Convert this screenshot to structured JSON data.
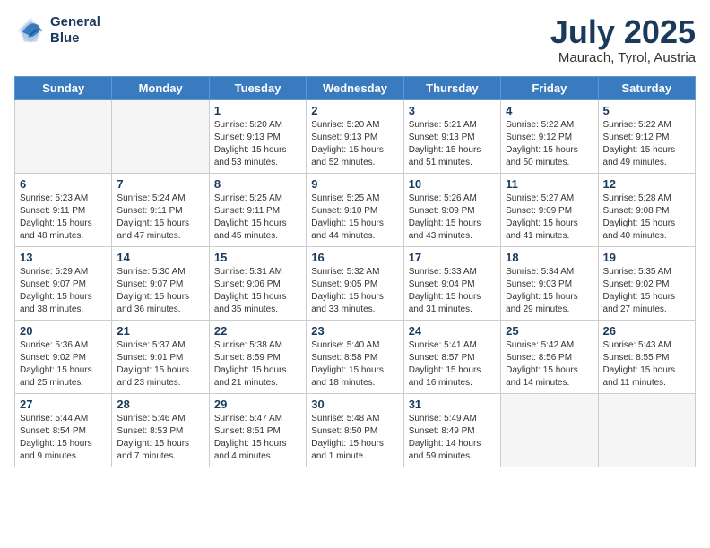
{
  "logo": {
    "line1": "General",
    "line2": "Blue"
  },
  "title": "July 2025",
  "subtitle": "Maurach, Tyrol, Austria",
  "days_of_week": [
    "Sunday",
    "Monday",
    "Tuesday",
    "Wednesday",
    "Thursday",
    "Friday",
    "Saturday"
  ],
  "weeks": [
    [
      {
        "day": "",
        "detail": ""
      },
      {
        "day": "",
        "detail": ""
      },
      {
        "day": "1",
        "detail": "Sunrise: 5:20 AM\nSunset: 9:13 PM\nDaylight: 15 hours\nand 53 minutes."
      },
      {
        "day": "2",
        "detail": "Sunrise: 5:20 AM\nSunset: 9:13 PM\nDaylight: 15 hours\nand 52 minutes."
      },
      {
        "day": "3",
        "detail": "Sunrise: 5:21 AM\nSunset: 9:13 PM\nDaylight: 15 hours\nand 51 minutes."
      },
      {
        "day": "4",
        "detail": "Sunrise: 5:22 AM\nSunset: 9:12 PM\nDaylight: 15 hours\nand 50 minutes."
      },
      {
        "day": "5",
        "detail": "Sunrise: 5:22 AM\nSunset: 9:12 PM\nDaylight: 15 hours\nand 49 minutes."
      }
    ],
    [
      {
        "day": "6",
        "detail": "Sunrise: 5:23 AM\nSunset: 9:11 PM\nDaylight: 15 hours\nand 48 minutes."
      },
      {
        "day": "7",
        "detail": "Sunrise: 5:24 AM\nSunset: 9:11 PM\nDaylight: 15 hours\nand 47 minutes."
      },
      {
        "day": "8",
        "detail": "Sunrise: 5:25 AM\nSunset: 9:11 PM\nDaylight: 15 hours\nand 45 minutes."
      },
      {
        "day": "9",
        "detail": "Sunrise: 5:25 AM\nSunset: 9:10 PM\nDaylight: 15 hours\nand 44 minutes."
      },
      {
        "day": "10",
        "detail": "Sunrise: 5:26 AM\nSunset: 9:09 PM\nDaylight: 15 hours\nand 43 minutes."
      },
      {
        "day": "11",
        "detail": "Sunrise: 5:27 AM\nSunset: 9:09 PM\nDaylight: 15 hours\nand 41 minutes."
      },
      {
        "day": "12",
        "detail": "Sunrise: 5:28 AM\nSunset: 9:08 PM\nDaylight: 15 hours\nand 40 minutes."
      }
    ],
    [
      {
        "day": "13",
        "detail": "Sunrise: 5:29 AM\nSunset: 9:07 PM\nDaylight: 15 hours\nand 38 minutes."
      },
      {
        "day": "14",
        "detail": "Sunrise: 5:30 AM\nSunset: 9:07 PM\nDaylight: 15 hours\nand 36 minutes."
      },
      {
        "day": "15",
        "detail": "Sunrise: 5:31 AM\nSunset: 9:06 PM\nDaylight: 15 hours\nand 35 minutes."
      },
      {
        "day": "16",
        "detail": "Sunrise: 5:32 AM\nSunset: 9:05 PM\nDaylight: 15 hours\nand 33 minutes."
      },
      {
        "day": "17",
        "detail": "Sunrise: 5:33 AM\nSunset: 9:04 PM\nDaylight: 15 hours\nand 31 minutes."
      },
      {
        "day": "18",
        "detail": "Sunrise: 5:34 AM\nSunset: 9:03 PM\nDaylight: 15 hours\nand 29 minutes."
      },
      {
        "day": "19",
        "detail": "Sunrise: 5:35 AM\nSunset: 9:02 PM\nDaylight: 15 hours\nand 27 minutes."
      }
    ],
    [
      {
        "day": "20",
        "detail": "Sunrise: 5:36 AM\nSunset: 9:02 PM\nDaylight: 15 hours\nand 25 minutes."
      },
      {
        "day": "21",
        "detail": "Sunrise: 5:37 AM\nSunset: 9:01 PM\nDaylight: 15 hours\nand 23 minutes."
      },
      {
        "day": "22",
        "detail": "Sunrise: 5:38 AM\nSunset: 8:59 PM\nDaylight: 15 hours\nand 21 minutes."
      },
      {
        "day": "23",
        "detail": "Sunrise: 5:40 AM\nSunset: 8:58 PM\nDaylight: 15 hours\nand 18 minutes."
      },
      {
        "day": "24",
        "detail": "Sunrise: 5:41 AM\nSunset: 8:57 PM\nDaylight: 15 hours\nand 16 minutes."
      },
      {
        "day": "25",
        "detail": "Sunrise: 5:42 AM\nSunset: 8:56 PM\nDaylight: 15 hours\nand 14 minutes."
      },
      {
        "day": "26",
        "detail": "Sunrise: 5:43 AM\nSunset: 8:55 PM\nDaylight: 15 hours\nand 11 minutes."
      }
    ],
    [
      {
        "day": "27",
        "detail": "Sunrise: 5:44 AM\nSunset: 8:54 PM\nDaylight: 15 hours\nand 9 minutes."
      },
      {
        "day": "28",
        "detail": "Sunrise: 5:46 AM\nSunset: 8:53 PM\nDaylight: 15 hours\nand 7 minutes."
      },
      {
        "day": "29",
        "detail": "Sunrise: 5:47 AM\nSunset: 8:51 PM\nDaylight: 15 hours\nand 4 minutes."
      },
      {
        "day": "30",
        "detail": "Sunrise: 5:48 AM\nSunset: 8:50 PM\nDaylight: 15 hours\nand 1 minute."
      },
      {
        "day": "31",
        "detail": "Sunrise: 5:49 AM\nSunset: 8:49 PM\nDaylight: 14 hours\nand 59 minutes."
      },
      {
        "day": "",
        "detail": ""
      },
      {
        "day": "",
        "detail": ""
      }
    ]
  ]
}
